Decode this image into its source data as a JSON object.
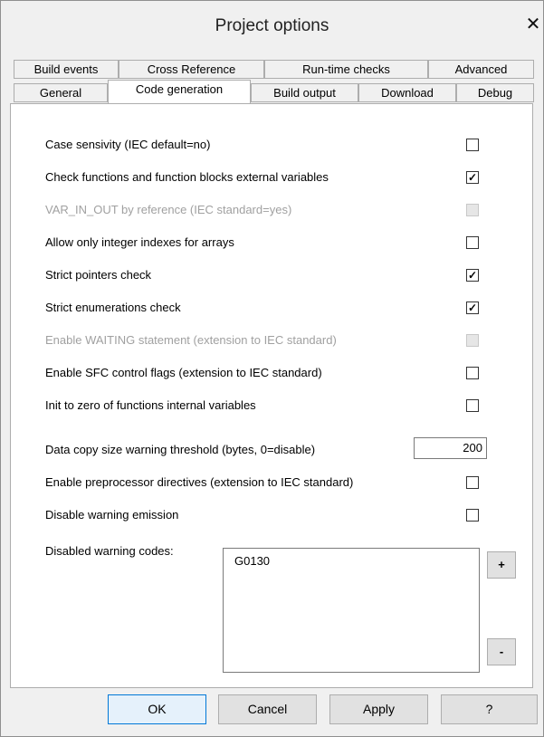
{
  "window": {
    "title": "Project options",
    "close_glyph": "✕"
  },
  "tabs_row1": [
    "Build events",
    "Cross Reference",
    "Run-time checks",
    "Advanced"
  ],
  "tabs_row2": [
    "General",
    "Code generation",
    "Build output",
    "Download",
    "Debug"
  ],
  "active_tab": "Code generation",
  "options": [
    {
      "label": "Case sensivity (IEC default=no)",
      "checked": false,
      "enabled": true
    },
    {
      "label": "Check functions and function blocks external variables",
      "checked": true,
      "enabled": true
    },
    {
      "label": "VAR_IN_OUT by reference (IEC standard=yes)",
      "checked": false,
      "enabled": false
    },
    {
      "label": "Allow only integer indexes for arrays",
      "checked": false,
      "enabled": true
    },
    {
      "label": "Strict pointers check",
      "checked": true,
      "enabled": true
    },
    {
      "label": "Strict enumerations check",
      "checked": true,
      "enabled": true
    },
    {
      "label": "Enable WAITING statement (extension to IEC standard)",
      "checked": false,
      "enabled": false
    },
    {
      "label": "Enable SFC control flags (extension to IEC standard)",
      "checked": false,
      "enabled": true
    },
    {
      "label": "Init to zero of functions internal variables",
      "checked": false,
      "enabled": true
    }
  ],
  "threshold": {
    "label": "Data copy size warning threshold (bytes, 0=disable)",
    "value": "200"
  },
  "options2": [
    {
      "label": "Enable preprocessor directives (extension to IEC standard)",
      "checked": false,
      "enabled": true
    },
    {
      "label": "Disable warning emission",
      "checked": false,
      "enabled": true
    }
  ],
  "disabled_warnings": {
    "label": "Disabled warning codes:",
    "items": [
      "G0130"
    ],
    "add_label": "+",
    "remove_label": "-"
  },
  "buttons": {
    "ok": "OK",
    "cancel": "Cancel",
    "apply": "Apply",
    "help": "?"
  }
}
